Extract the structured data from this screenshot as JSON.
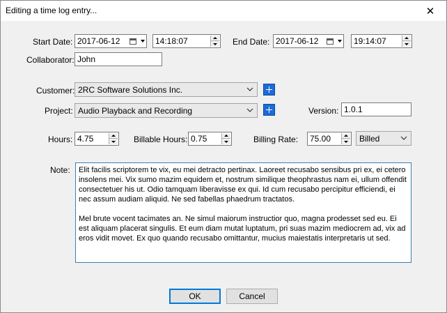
{
  "window": {
    "title": "Editing a time log entry...",
    "close_glyph": "✕"
  },
  "dates": {
    "start_label": "Start Date:",
    "start_date": "2017-06-12",
    "start_time": "14:18:07",
    "end_label": "End Date:",
    "end_date": "2017-06-12",
    "end_time": "19:14:07"
  },
  "collaborator": {
    "label": "Collaborator:",
    "value": "John"
  },
  "customer": {
    "label": "Customer:",
    "value": "2RC Software Solutions Inc."
  },
  "project": {
    "label": "Project:",
    "value": "Audio Playback and Recording"
  },
  "version": {
    "label": "Version:",
    "value": "1.0.1"
  },
  "hours": {
    "label": "Hours:",
    "value": "4.75"
  },
  "billable_hours": {
    "label": "Billable Hours:",
    "value": "0.75"
  },
  "billing_rate": {
    "label": "Billing Rate:",
    "value": "75.00"
  },
  "billing_status": {
    "value": "Billed"
  },
  "note": {
    "label": "Note:",
    "paragraph1": "Elit facilis scriptorem te vix, eu mei detracto pertinax. Laoreet recusabo sensibus pri ex, ei cetero insolens mei. Vix sumo mazim equidem et, nostrum similique theophrastus nam ei, ullum offendit consectetuer his ut. Odio tamquam liberavisse ex qui. Id cum recusabo percipitur efficiendi, ei nec assum audiam aliquid. Ne sed fabellas phaedrum tractatos.",
    "paragraph2": "Mel brute vocent tacimates an. Ne simul maiorum instructior quo, magna prodesset sed eu. Ei est aliquam placerat singulis. Et eum diam mutat luptatum, pri suas mazim mediocrem ad, vix ad eros vidit movet. Ex quo quando recusabo omittantur, mucius maiestatis interpretaris ut sed."
  },
  "buttons": {
    "ok": "OK",
    "cancel": "Cancel"
  },
  "colors": {
    "accent": "#0078d7",
    "plus_button": "#1e6bd6",
    "dialog_bg": "#f0f0f0"
  }
}
